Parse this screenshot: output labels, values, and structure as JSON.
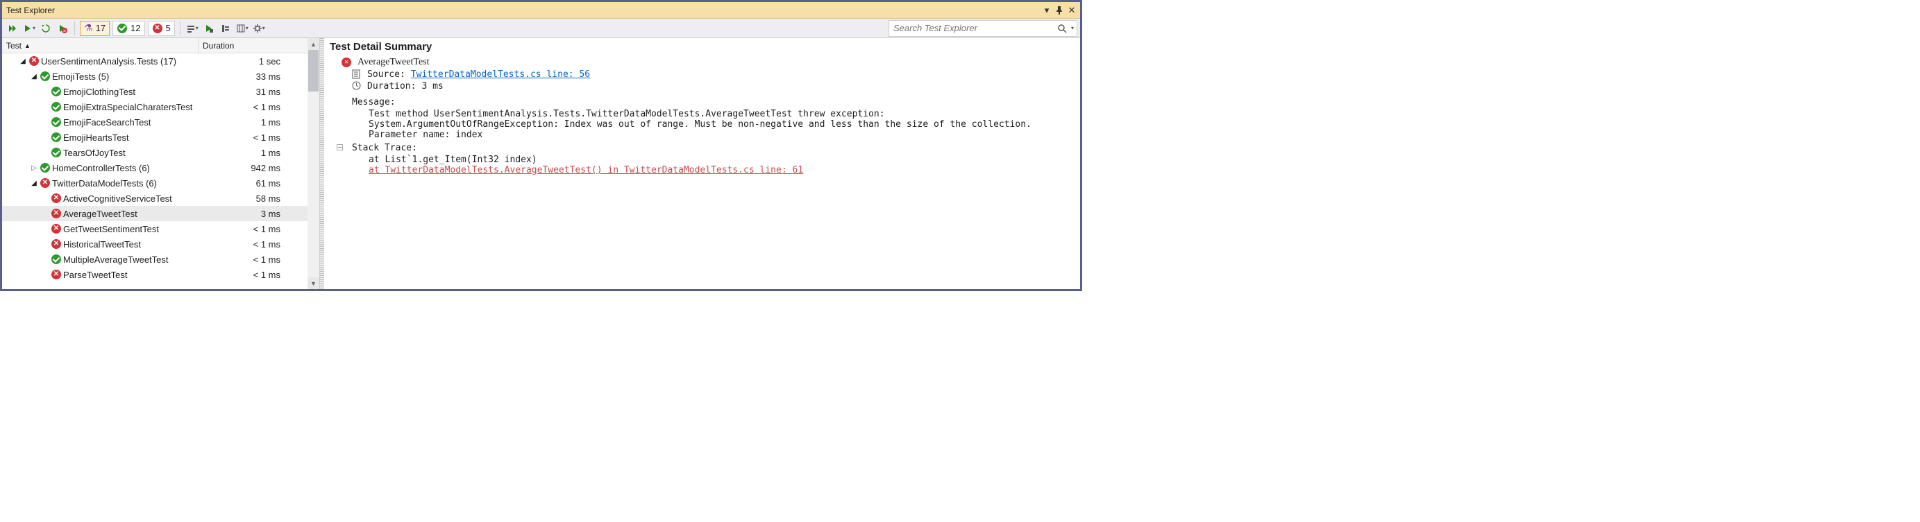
{
  "window": {
    "title": "Test Explorer"
  },
  "toolbar": {
    "filters": {
      "total": "17",
      "passed": "12",
      "failed": "5"
    },
    "search_placeholder": "Search Test Explorer"
  },
  "columns": {
    "test": "Test",
    "duration": "Duration"
  },
  "tree": [
    {
      "indent": 1,
      "caret": "down",
      "status": "fail",
      "name": "UserSentimentAnalysis.Tests",
      "count": "(17)",
      "duration": "1 sec"
    },
    {
      "indent": 2,
      "caret": "down",
      "status": "pass",
      "name": "EmojiTests",
      "count": "(5)",
      "duration": "33 ms"
    },
    {
      "indent": 3,
      "caret": "",
      "status": "pass",
      "name": "EmojiClothingTest",
      "duration": "31 ms"
    },
    {
      "indent": 3,
      "caret": "",
      "status": "pass",
      "name": "EmojiExtraSpecialCharatersTest",
      "duration": "< 1 ms"
    },
    {
      "indent": 3,
      "caret": "",
      "status": "pass",
      "name": "EmojiFaceSearchTest",
      "duration": "1 ms"
    },
    {
      "indent": 3,
      "caret": "",
      "status": "pass",
      "name": "EmojiHeartsTest",
      "duration": "< 1 ms"
    },
    {
      "indent": 3,
      "caret": "",
      "status": "pass",
      "name": "TearsOfJoyTest",
      "duration": "1 ms"
    },
    {
      "indent": 2,
      "caret": "right",
      "status": "pass",
      "name": "HomeControllerTests",
      "count": "(6)",
      "duration": "942 ms"
    },
    {
      "indent": 2,
      "caret": "down",
      "status": "fail",
      "name": "TwitterDataModelTests",
      "count": "(6)",
      "duration": "61 ms"
    },
    {
      "indent": 3,
      "caret": "",
      "status": "fail",
      "name": "ActiveCognitiveServiceTest",
      "duration": "58 ms"
    },
    {
      "indent": 3,
      "caret": "",
      "status": "fail",
      "name": "AverageTweetTest",
      "duration": "3 ms",
      "selected": true
    },
    {
      "indent": 3,
      "caret": "",
      "status": "fail",
      "name": "GetTweetSentimentTest",
      "duration": "< 1 ms"
    },
    {
      "indent": 3,
      "caret": "",
      "status": "fail",
      "name": "HistoricalTweetTest",
      "duration": "< 1 ms"
    },
    {
      "indent": 3,
      "caret": "",
      "status": "pass",
      "name": "MultipleAverageTweetTest",
      "duration": "< 1 ms"
    },
    {
      "indent": 3,
      "caret": "",
      "status": "fail",
      "name": "ParseTweetTest",
      "duration": "< 1 ms"
    }
  ],
  "detail": {
    "title": "Test Detail Summary",
    "test_name": "AverageTweetTest",
    "source_label": "Source:",
    "source_link": "TwitterDataModelTests.cs line: 56",
    "duration_label": "Duration:",
    "duration_value": "3 ms",
    "message_label": "Message:",
    "message_lines": [
      "Test method UserSentimentAnalysis.Tests.TwitterDataModelTests.AverageTweetTest threw exception:",
      "System.ArgumentOutOfRangeException: Index was out of range. Must be non-negative and less than the size of the collection.",
      "Parameter name: index"
    ],
    "stack_label": "Stack Trace:",
    "stack_lines": [
      {
        "text": "at List`1.get_Item(Int32 index)",
        "link": false
      },
      {
        "text": "at TwitterDataModelTests.AverageTweetTest() in TwitterDataModelTests.cs line: 61",
        "link": true
      }
    ]
  }
}
